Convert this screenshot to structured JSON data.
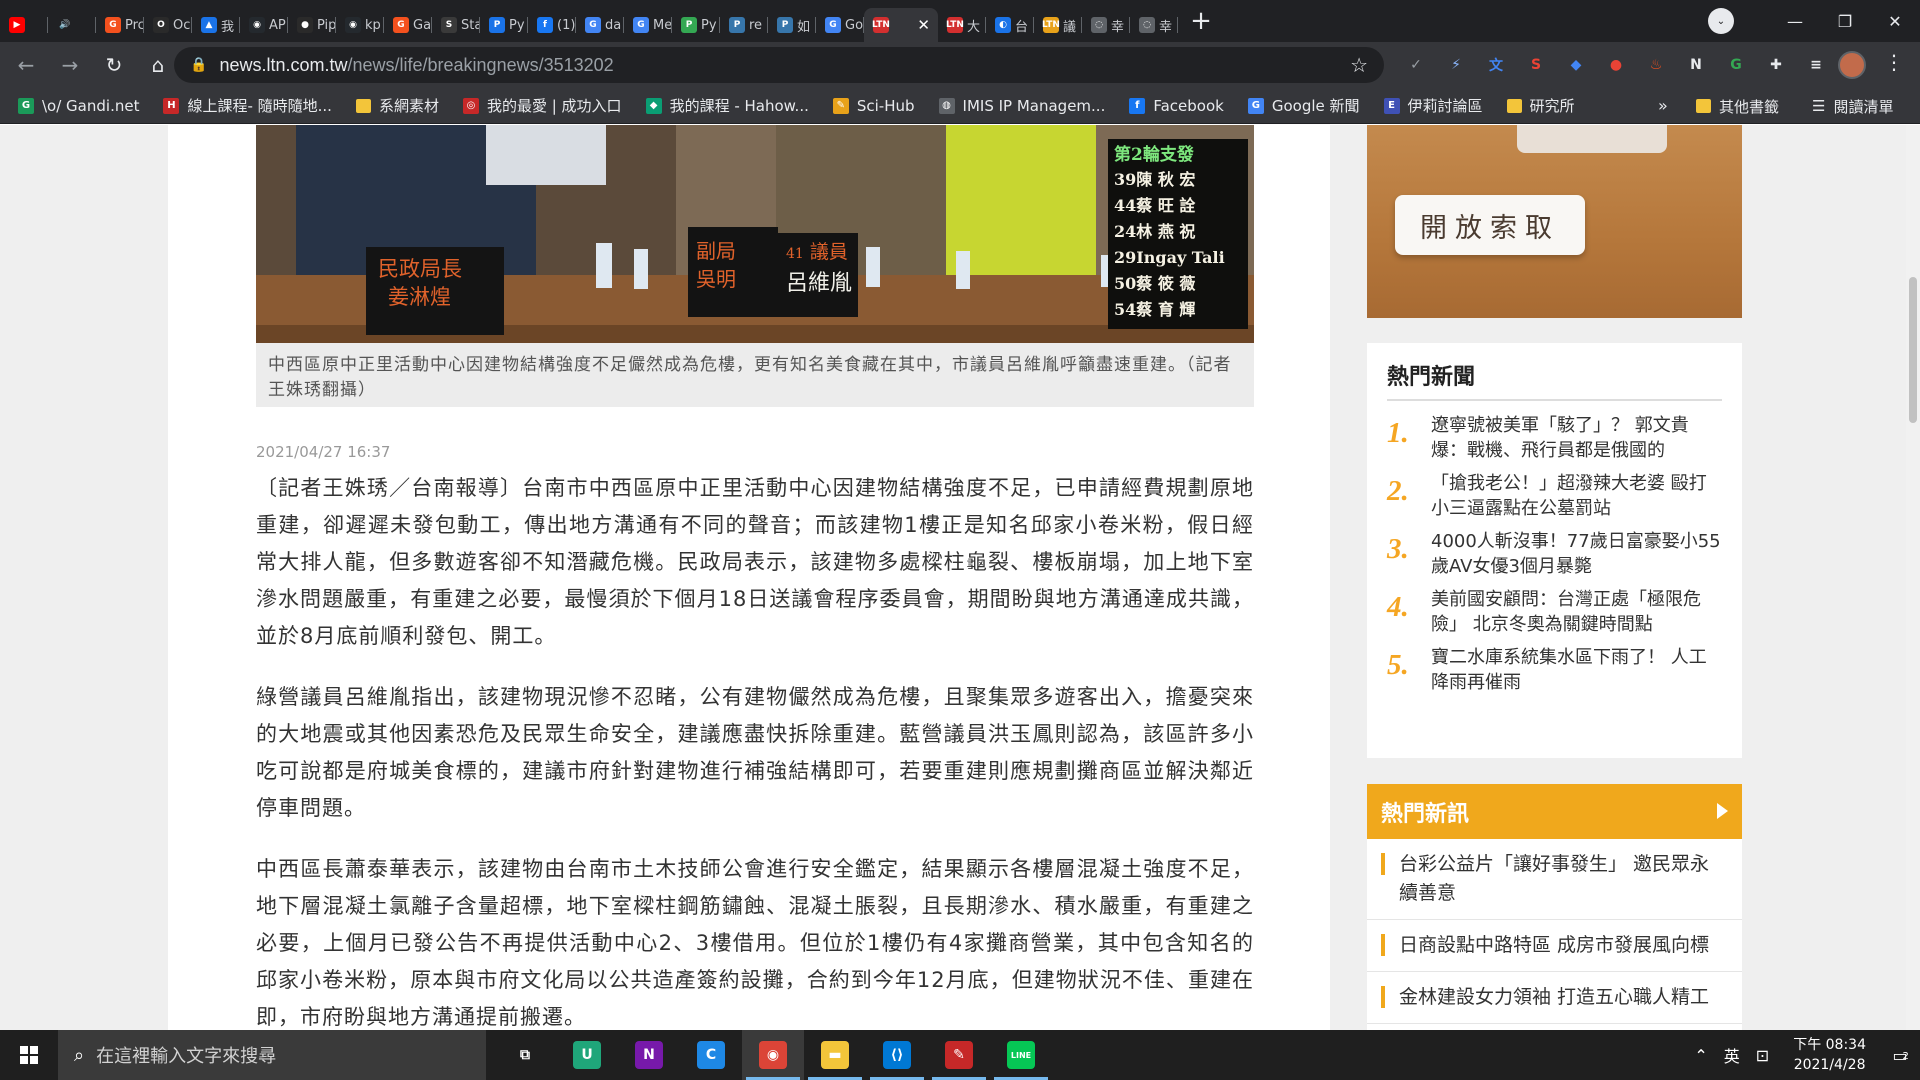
{
  "browser": {
    "tabs": [
      {
        "label": "",
        "color": "#ff0000",
        "glyph": "▶"
      },
      {
        "label": "",
        "color": "#202124",
        "glyph": "🔊"
      },
      {
        "label": "Prc",
        "color": "#f4511e",
        "glyph": "G"
      },
      {
        "label": "Oc",
        "color": "#2a2a2a",
        "glyph": "O"
      },
      {
        "label": "我",
        "color": "#1a73e8",
        "glyph": "▲"
      },
      {
        "label": "AP",
        "color": "#24292e",
        "glyph": "◉"
      },
      {
        "label": "Pip",
        "color": "#2a2a2a",
        "glyph": "●"
      },
      {
        "label": "kp",
        "color": "#24292e",
        "glyph": "◉"
      },
      {
        "label": "Ga",
        "color": "#f4511e",
        "glyph": "G"
      },
      {
        "label": "Sta",
        "color": "#3a3a3a",
        "glyph": "S"
      },
      {
        "label": "Py",
        "color": "#1a73e8",
        "glyph": "P"
      },
      {
        "label": "(1)",
        "color": "#1877f2",
        "glyph": "f"
      },
      {
        "label": "da",
        "color": "#4285f4",
        "glyph": "G"
      },
      {
        "label": "Me",
        "color": "#4285f4",
        "glyph": "G"
      },
      {
        "label": "Py",
        "color": "#34a853",
        "glyph": "P"
      },
      {
        "label": "re",
        "color": "#3776ab",
        "glyph": "P"
      },
      {
        "label": "如",
        "color": "#3776ab",
        "glyph": "P"
      },
      {
        "label": "Go",
        "color": "#4285f4",
        "glyph": "G"
      },
      {
        "label": "",
        "color": "#d32f2f",
        "glyph": "LTN",
        "active": true
      },
      {
        "label": "大",
        "color": "#d32f2f",
        "glyph": "LTN"
      },
      {
        "label": "台",
        "color": "#1a73e8",
        "glyph": "◐"
      },
      {
        "label": "議",
        "color": "#e8a21a",
        "glyph": "LTN"
      },
      {
        "label": "幸",
        "color": "#5f6368",
        "glyph": "◌"
      },
      {
        "label": "幸",
        "color": "#5f6368",
        "glyph": "◌"
      }
    ],
    "active_tab_close": "✕",
    "new_tab": "+",
    "window_controls": {
      "minimize": "—",
      "maximize": "❐",
      "close": "✕"
    },
    "tab_search": "⌄",
    "nav": {
      "back": "←",
      "forward": "→",
      "reload": "↻",
      "home": "⌂"
    },
    "url_host": "news.ltn.com.tw",
    "url_path": "/news/life/breakingnews/3513202",
    "extensions": [
      {
        "glyph": "✓",
        "color": "#9aa0a6"
      },
      {
        "glyph": "⚡",
        "color": "#8ab4f8"
      },
      {
        "glyph": "文",
        "color": "#4285f4"
      },
      {
        "glyph": "S",
        "color": "#ea4335"
      },
      {
        "glyph": "◆",
        "color": "#4285f4"
      },
      {
        "glyph": "●",
        "color": "#ea4335"
      },
      {
        "glyph": "♨",
        "color": "#f4511e"
      },
      {
        "glyph": "N",
        "color": "#e8eaed"
      },
      {
        "glyph": "G",
        "color": "#34a853"
      },
      {
        "glyph": "✚",
        "color": "#e8eaed"
      },
      {
        "glyph": "≡",
        "color": "#e8eaed"
      }
    ],
    "menu": "⋮",
    "bookmarks": [
      {
        "label": "\\o/ Gandi.net",
        "color": "#1b9a59",
        "glyph": "G"
      },
      {
        "label": "線上課程- 隨時隨地...",
        "color": "#c62828",
        "glyph": "H"
      },
      {
        "label": "系網素材",
        "color": "#f3c53a",
        "glyph": ""
      },
      {
        "label": "我的最愛 | 成功入口",
        "color": "#c62828",
        "glyph": "◎"
      },
      {
        "label": "我的課程 - Hahow...",
        "color": "#0a9e74",
        "glyph": "◆"
      },
      {
        "label": "Sci-Hub",
        "color": "#e8a21a",
        "glyph": "✎"
      },
      {
        "label": "IMIS IP Managem...",
        "color": "#5f6368",
        "glyph": "◍"
      },
      {
        "label": "Facebook",
        "color": "#1877f2",
        "glyph": "f"
      },
      {
        "label": "Google 新聞",
        "color": "#4285f4",
        "glyph": "G"
      },
      {
        "label": "伊莉討論區",
        "color": "#3f51b5",
        "glyph": "E"
      },
      {
        "label": "研究所",
        "color": "#f3c53a",
        "glyph": ""
      }
    ],
    "bookmarks_more": "»",
    "other_bookmarks": "其他書籤",
    "reading_list": "閱讀清單"
  },
  "article": {
    "image_overlay": {
      "panel_title": "第2輪支發",
      "speakers": [
        "39陳 秋 宏",
        "44蔡 旺 詮",
        "24林 燕 祝",
        "29Ingay Tali",
        "50蔡 筱 薇",
        "54蔡 育 輝"
      ],
      "sign_left": [
        "民政局長",
        "姜淋煌"
      ],
      "sign_mid": [
        "副局",
        "吳明"
      ],
      "sign_right_num": "41",
      "sign_right": [
        "議員",
        "呂維胤"
      ]
    },
    "caption": "中西區原中正里活動中心因建物結構強度不足儼然成為危樓，更有知名美食藏在其中，市議員呂維胤呼籲盡速重建。（記者王姝琇翻攝）",
    "date": "2021/04/27 16:37",
    "paragraphs": [
      "〔記者王姝琇／台南報導〕台南市中西區原中正里活動中心因建物結構強度不足，已申請經費規劃原地重建，卻遲遲未發包動工，傳出地方溝通有不同的聲音；而該建物1樓正是知名邱家小卷米粉，假日經常大排人龍，但多數遊客卻不知潛藏危機。民政局表示，該建物多處樑柱龜裂、樓板崩塌，加上地下室滲水問題嚴重，有重建之必要，最慢須於下個月18日送議會程序委員會，期間盼與地方溝通達成共識，並於8月底前順利發包、開工。",
      "綠營議員呂維胤指出，該建物現況慘不忍睹，公有建物儼然成為危樓，且聚集眾多遊客出入，擔憂突來的大地震或其他因素恐危及民眾生命安全，建議應盡快拆除重建。藍營議員洪玉鳳則認為，該區許多小吃可說都是府城美食標的，建議市府針對建物進行補強結構即可，若要重建則應規劃攤商區並解決鄰近停車問題。",
      "中西區長蕭泰華表示，該建物由台南市土木技師公會進行安全鑑定，結果顯示各樓層混凝土強度不足，地下層混凝土氯離子含量超標，地下室樑柱鋼筋鏽蝕、混凝土脹裂，且長期滲水、積水嚴重，有重建之必要，上個月已發公告不再提供活動中心2、3樓借用。但位於1樓仍有4家攤商營業，其中包含知名的邱家小卷米粉，原本與市府文化局以公共造產簽約設攤，合約到今年12月底，但建物狀況不佳、重建在即，市府盼與地方溝通提前搬遷。"
    ]
  },
  "sidebar": {
    "ad_button": "開放索取",
    "hot_title": "熱門新聞",
    "hot_items": [
      {
        "num": "1.",
        "title": "遼寧號被美軍「駭了」？ 郭文貴爆：戰機、飛行員都是俄國的"
      },
      {
        "num": "2.",
        "title": "「搶我老公！」超潑辣大老婆 毆打小三逼露點在公墓罰站"
      },
      {
        "num": "3.",
        "title": "4000人斬沒事！77歲日富豪娶小55歲AV女優3個月暴斃"
      },
      {
        "num": "4.",
        "title": "美前國安顧問：台灣正處「極限危險」 北京冬奧為關鍵時間點"
      },
      {
        "num": "5.",
        "title": "寶二水庫系統集水區下雨了！ 人工降雨再催雨"
      }
    ],
    "news_title": "熱門新訊",
    "news_items": [
      "台彩公益片「讓好事發生」 邀民眾永續善意",
      "日商設點中路特區 成房市發展風向標",
      "金林建設女力領袖 打造五心職人精工"
    ],
    "accent": "#f0a81c"
  },
  "taskbar": {
    "search_placeholder": "在這裡輸入文字來搜尋",
    "apps": [
      {
        "name": "task-view",
        "glyph": "⧉",
        "color": "transparent"
      },
      {
        "name": "app-u",
        "glyph": "U",
        "color": "#1fa67a"
      },
      {
        "name": "onenote",
        "glyph": "N",
        "color": "#7719aa"
      },
      {
        "name": "app-c",
        "glyph": "C",
        "color": "#1e88e5"
      },
      {
        "name": "chrome",
        "glyph": "◉",
        "color": "#db4437"
      },
      {
        "name": "file-explorer",
        "glyph": "▬",
        "color": "#f3c53a"
      },
      {
        "name": "vscode",
        "glyph": "⟨⟩",
        "color": "#0078d4"
      },
      {
        "name": "app-pen",
        "glyph": "✎",
        "color": "#c62828"
      },
      {
        "name": "line",
        "glyph": "LINE",
        "color": "#06c755"
      }
    ],
    "ime": "英",
    "clock_time": "下午 08:34",
    "clock_date": "2021/4/28",
    "notifications": "2"
  }
}
